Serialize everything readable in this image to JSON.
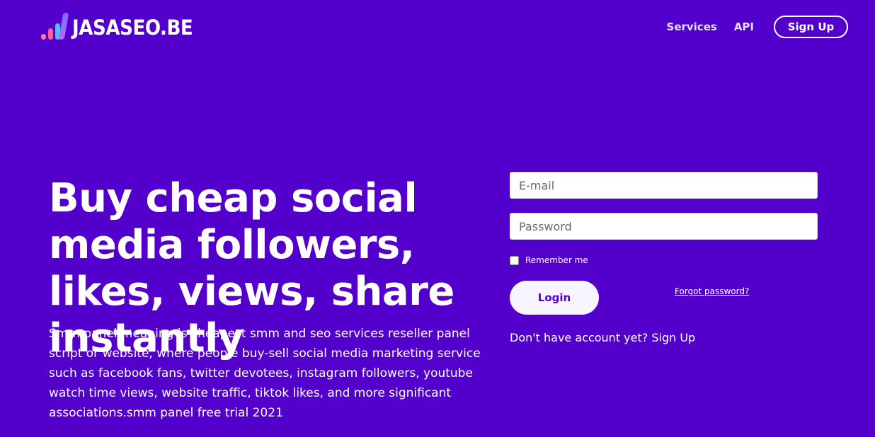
{
  "brand": {
    "name": "JASASEO.BE"
  },
  "nav": {
    "services": "Services",
    "api": "API",
    "signup": "Sign Up"
  },
  "hero": {
    "title": "Buy cheap social media followers, likes, views, share instantly",
    "description": "Smm panel meaning is cheapest smm and seo services reseller panel script or website, where people buy-sell social media marketing service such as facebook fans, twitter devotees, instagram followers, youtube watch time views, website traffic, tiktok likes, and more significant associations.smm panel free trial 2021"
  },
  "login_form": {
    "email_placeholder": "E-mail",
    "password_placeholder": "Password",
    "remember_label": "Remember me",
    "login_label": "Login",
    "forgot_label": "Forgot password?",
    "signup_prompt": "Don't have account yet? Sign Up"
  },
  "colors": {
    "background": "#5400cc",
    "login_text": "#5400cc"
  },
  "icons": {
    "logo": "bar-chart-logo-icon"
  }
}
